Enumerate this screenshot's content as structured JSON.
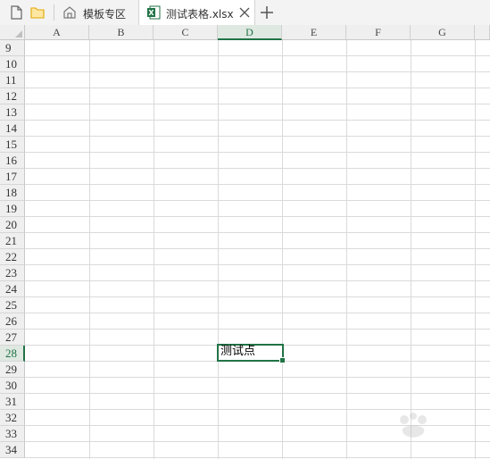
{
  "tabbar": {
    "new_doc_icon": "new-document-icon",
    "open_folder_icon": "folder-icon",
    "tabs": [
      {
        "label": "模板专区",
        "icon": "home-icon",
        "active": false
      },
      {
        "label": "测试表格.xlsx",
        "icon": "excel-file-icon",
        "active": true
      }
    ],
    "close_icon": "close-icon",
    "new_tab_icon": "plus-icon"
  },
  "sheet": {
    "columns": [
      "A",
      "B",
      "C",
      "D",
      "E",
      "F",
      "G"
    ],
    "selected_column": "D",
    "rows": [
      "9",
      "10",
      "11",
      "12",
      "13",
      "14",
      "15",
      "16",
      "17",
      "18",
      "19",
      "20",
      "21",
      "22",
      "23",
      "24",
      "25",
      "26",
      "27",
      "28",
      "29",
      "30",
      "31",
      "32",
      "33",
      "34"
    ],
    "selected_row": "28",
    "active_cell": {
      "ref": "D28",
      "value": "测试点"
    }
  },
  "colors": {
    "accent": "#217346",
    "header_bg": "#efefef",
    "grid": "#dadada"
  }
}
